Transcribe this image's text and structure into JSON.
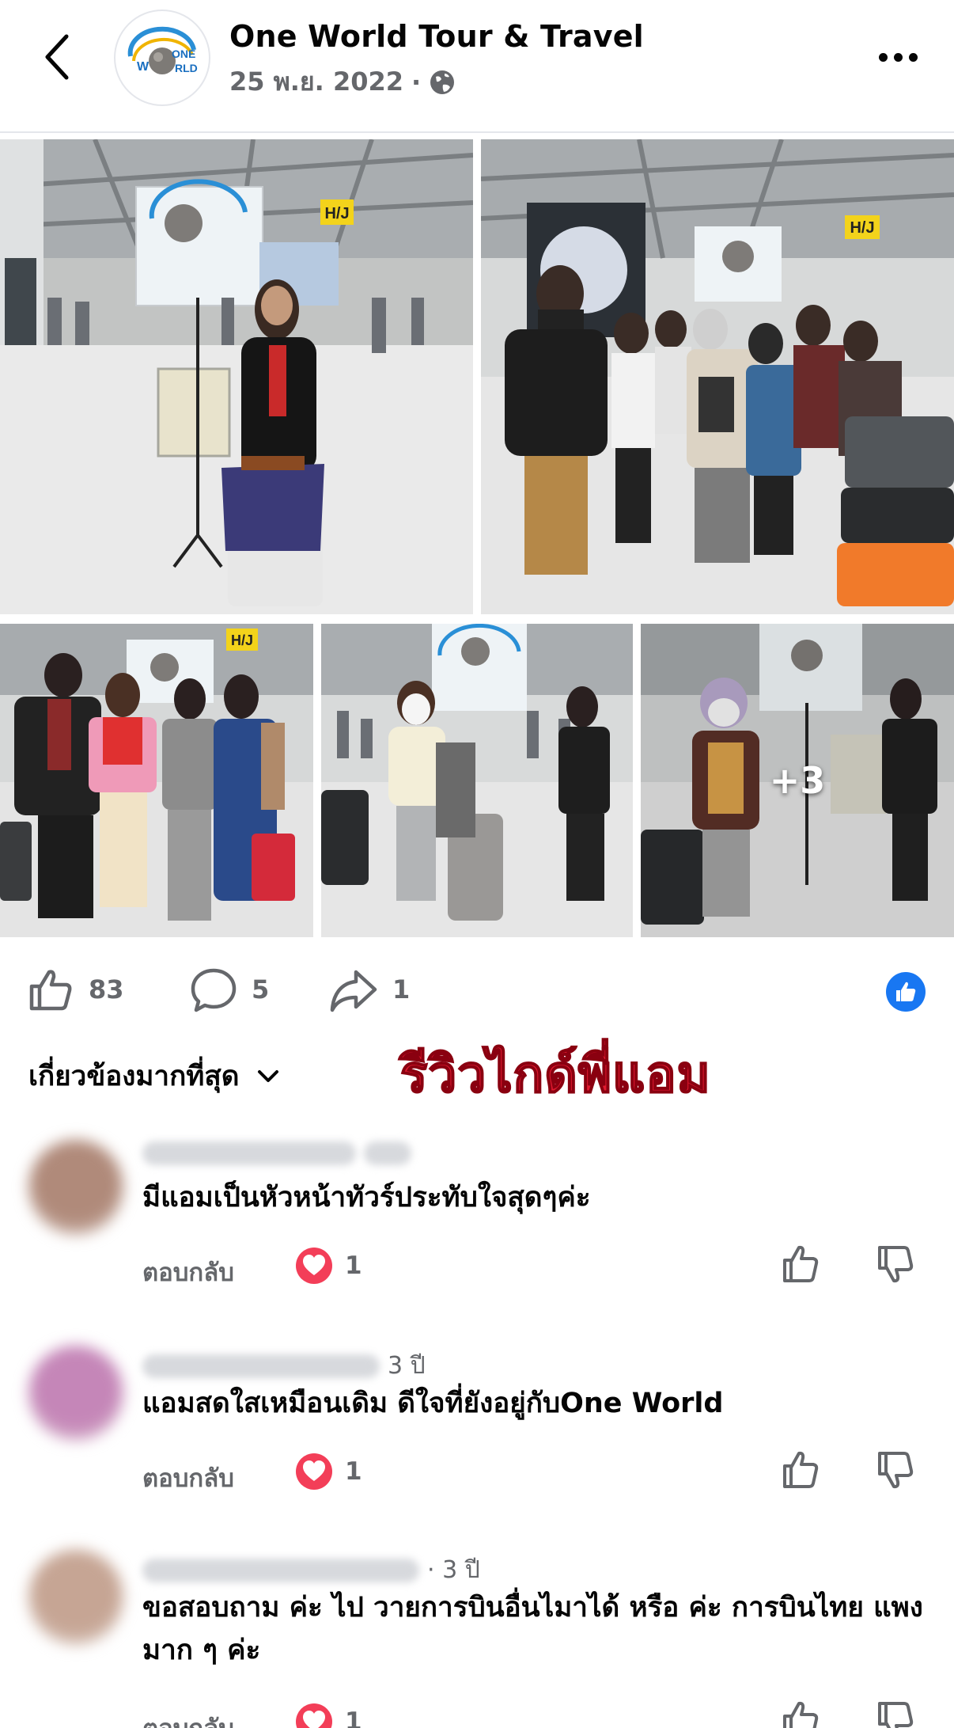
{
  "header": {
    "page_name": "One World Tour & Travel",
    "date": "25 พ.ย. 2022",
    "separator": "·",
    "logo_text": "ONE WORLD"
  },
  "photos": {
    "extra_count": "+3",
    "signs": [
      "H/J",
      "H/J",
      "H/J"
    ]
  },
  "actions": {
    "likes": "83",
    "comments": "5",
    "shares": "1"
  },
  "sort": {
    "label": "เกี่ยวข้องมากที่สุด"
  },
  "review_label": "รีวิวไกด์พี่แอม",
  "comments": [
    {
      "time": "",
      "text": "มีแอมเป็นหัวหน้าทัวร์ประทับใจสุดๆค่ะ",
      "reply_label": "ตอบกลับ",
      "reactions": "1",
      "avatar_color": "#b08a7a"
    },
    {
      "time": "3 ปี",
      "text": "แอมสดใสเหมือนเดิม ดีใจที่ยังอยู่กับOne World",
      "reply_label": "ตอบกลับ",
      "reactions": "1",
      "avatar_color": "#c586b8"
    },
    {
      "time": "· 3 ปี",
      "text": "ขอสอบถาม ค่ะ ไป วายการบินอื่นไมาได้ หรือ ค่ะ  การบินไทย แพงมาก ๆ  ค่ะ",
      "reply_label": "ตอบกลับ",
      "reactions": "1",
      "avatar_color": "#c6a594"
    }
  ],
  "colors": {
    "accent": "#1877f2",
    "review_red": "#e01a2f",
    "heart": "#f33e58",
    "muted": "#65676b"
  }
}
